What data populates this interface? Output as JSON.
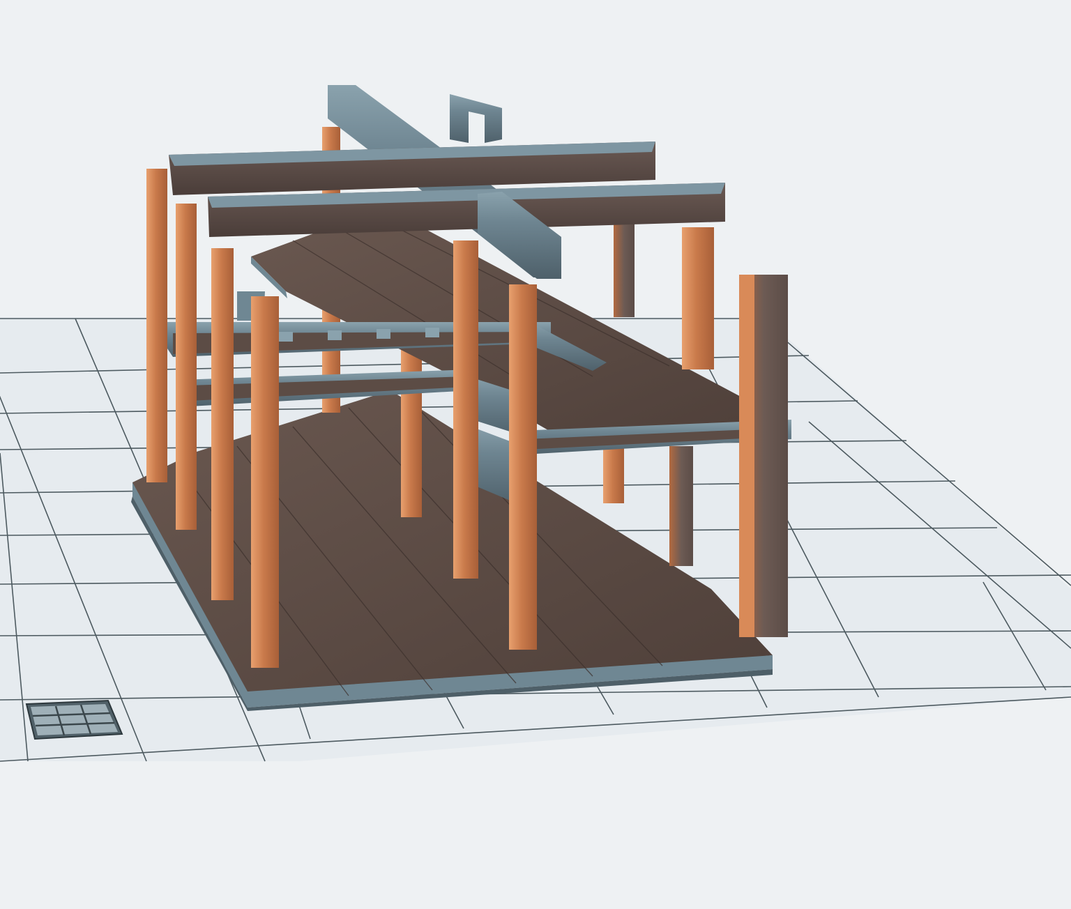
{
  "scene": {
    "subject": "architectural-frame-model",
    "colors": {
      "background": "#eef1f3",
      "grid_tile": "#e6ebef",
      "grid_line": "#4d5a60",
      "floor_wood": "#5c4c45",
      "floor_edge": "#6f8793",
      "steel_beam": "#6e8591",
      "steel_beam_dark": "#546771",
      "timber_column": "#c8784a",
      "timber_column_light": "#e49a68"
    },
    "icons": [
      "grid-tile-icon"
    ]
  }
}
